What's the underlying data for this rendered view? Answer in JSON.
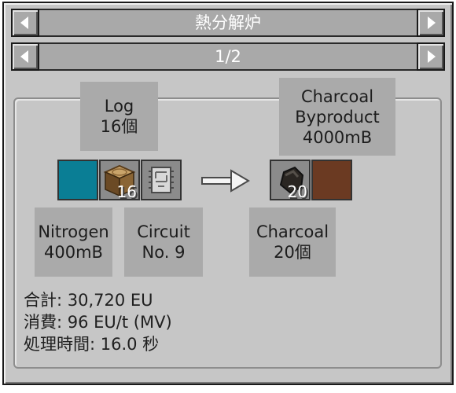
{
  "header": {
    "title": "熱分解炉",
    "page": "1/2"
  },
  "inputs": {
    "fluid": {
      "name": "Nitrogen",
      "amount": "400mB",
      "color": "#0a7e95"
    },
    "item": {
      "name": "Log",
      "amount": "16個",
      "count": "16"
    },
    "circuit": {
      "name": "Circuit",
      "number": "No. 9"
    }
  },
  "outputs": {
    "item": {
      "name": "Charcoal",
      "amount": "20個",
      "count": "20"
    },
    "fluid": {
      "name_line1": "Charcoal",
      "name_line2": "Byproduct",
      "amount": "4000mB",
      "color": "#6b3a22"
    }
  },
  "stats": {
    "total": "合計: 30,720 EU",
    "usage": "消費: 96 EU/t (MV)",
    "time": "処理時間: 16.0 秒"
  },
  "icons": [
    "arrow-left-icon",
    "arrow-right-icon",
    "log-icon",
    "circuit-icon",
    "charcoal-icon",
    "process-arrow-icon"
  ]
}
